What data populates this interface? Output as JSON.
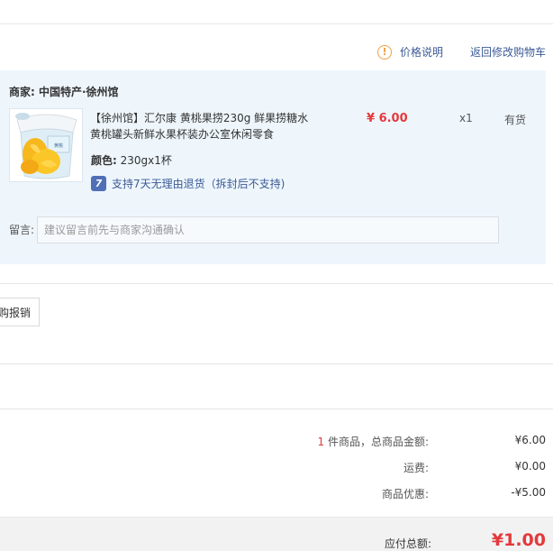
{
  "top_links": {
    "price_info_label": "价格说明",
    "back_to_cart_label": "返回修改购物车"
  },
  "shop": {
    "label": "商家:",
    "name": "中国特产·徐州馆"
  },
  "item": {
    "title": "【徐州馆】汇尔康 黄桃果捞230g 鲜果捞糖水黄桃罐头新鲜水果杯装办公室休闲零食",
    "price": "¥ 6.00",
    "quantity": "x1",
    "stock": "有货",
    "spec_label": "颜色:",
    "spec_value": "230gx1杯",
    "return_icon_glyph": "7",
    "return_policy": "支持7天无理由退货（拆封后不支持)",
    "thumbnail_icon": "peach-can-image"
  },
  "memo": {
    "label": "留言:",
    "placeholder": "建议留言前先与商家沟通确认"
  },
  "reimburse_button_label": "购报销",
  "summary": {
    "count": "1",
    "goods_total_label": " 件商品，总商品金额:",
    "goods_total_value": "¥6.00",
    "shipping_label": "运费:",
    "shipping_value": "¥0.00",
    "discount_label": "商品优惠:",
    "discount_value": "-¥5.00",
    "payable_label": "应付总额:",
    "payable_value": "¥1.00"
  },
  "colors": {
    "accent_red": "#e4393c",
    "link_blue": "#3c5a96",
    "box_bg": "#eef6fc"
  }
}
